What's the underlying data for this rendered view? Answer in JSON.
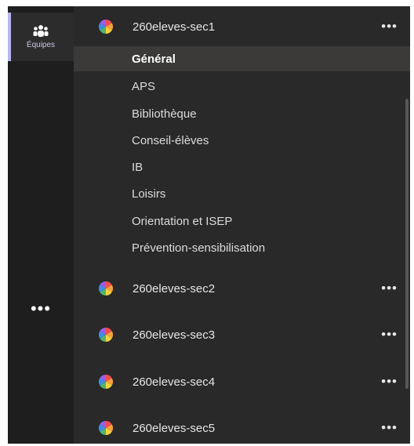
{
  "rail": {
    "teams_label": "Équipes",
    "more_label": "•••"
  },
  "teams": [
    {
      "name": "260eleves-sec1",
      "more": "•••",
      "channels": [
        "Général",
        "APS",
        "Bibliothèque",
        "Conseil-élèves",
        "IB",
        "Loisirs",
        "Orientation et ISEP",
        "Prévention-sensibilisation"
      ],
      "active_channel": "Général"
    },
    {
      "name": "260eleves-sec2",
      "more": "•••"
    },
    {
      "name": "260eleves-sec3",
      "more": "•••"
    },
    {
      "name": "260eleves-sec4",
      "more": "•••"
    },
    {
      "name": "260eleves-sec5",
      "more": "•••"
    }
  ],
  "colors": {
    "rail_bg": "#1e1e1e",
    "panel_bg": "#292929",
    "accent": "#b6b6f0",
    "active_channel_bg": "#3b3a39"
  },
  "icons": {
    "rail_teams": "teams-icon",
    "team_avatar": "team-avatar-icon"
  }
}
